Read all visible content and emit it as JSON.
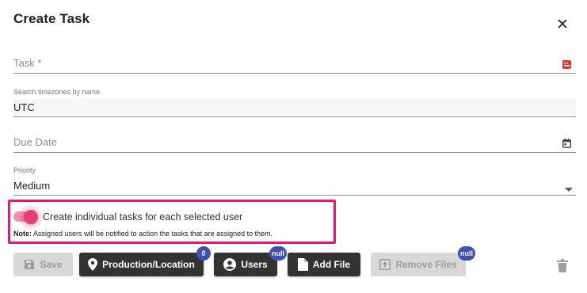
{
  "dialog": {
    "title": "Create Task"
  },
  "task_field": {
    "placeholder": "Task *"
  },
  "timezone_field": {
    "label": "Search timezones by name.",
    "value": "UTC"
  },
  "due_date_field": {
    "placeholder": "Due Date"
  },
  "priority_field": {
    "label": "Priority",
    "value": "Medium"
  },
  "toggle": {
    "label": "Create individual tasks for each selected user",
    "checked": true
  },
  "note": {
    "prefix": "Note:",
    "text": " Assigned users will be notified to action the tasks that are assigned to them."
  },
  "buttons": {
    "save": "Save",
    "production_location": "Production/Location",
    "production_location_badge": "0",
    "users": "Users",
    "users_badge": "null",
    "add_file": "Add File",
    "remove_files": "Remove Files",
    "remove_files_badge": "null"
  },
  "colors": {
    "accent": "#e83e73",
    "highlight": "#e8186d",
    "badge": "#3f51b5",
    "button_dark": "#333333"
  }
}
